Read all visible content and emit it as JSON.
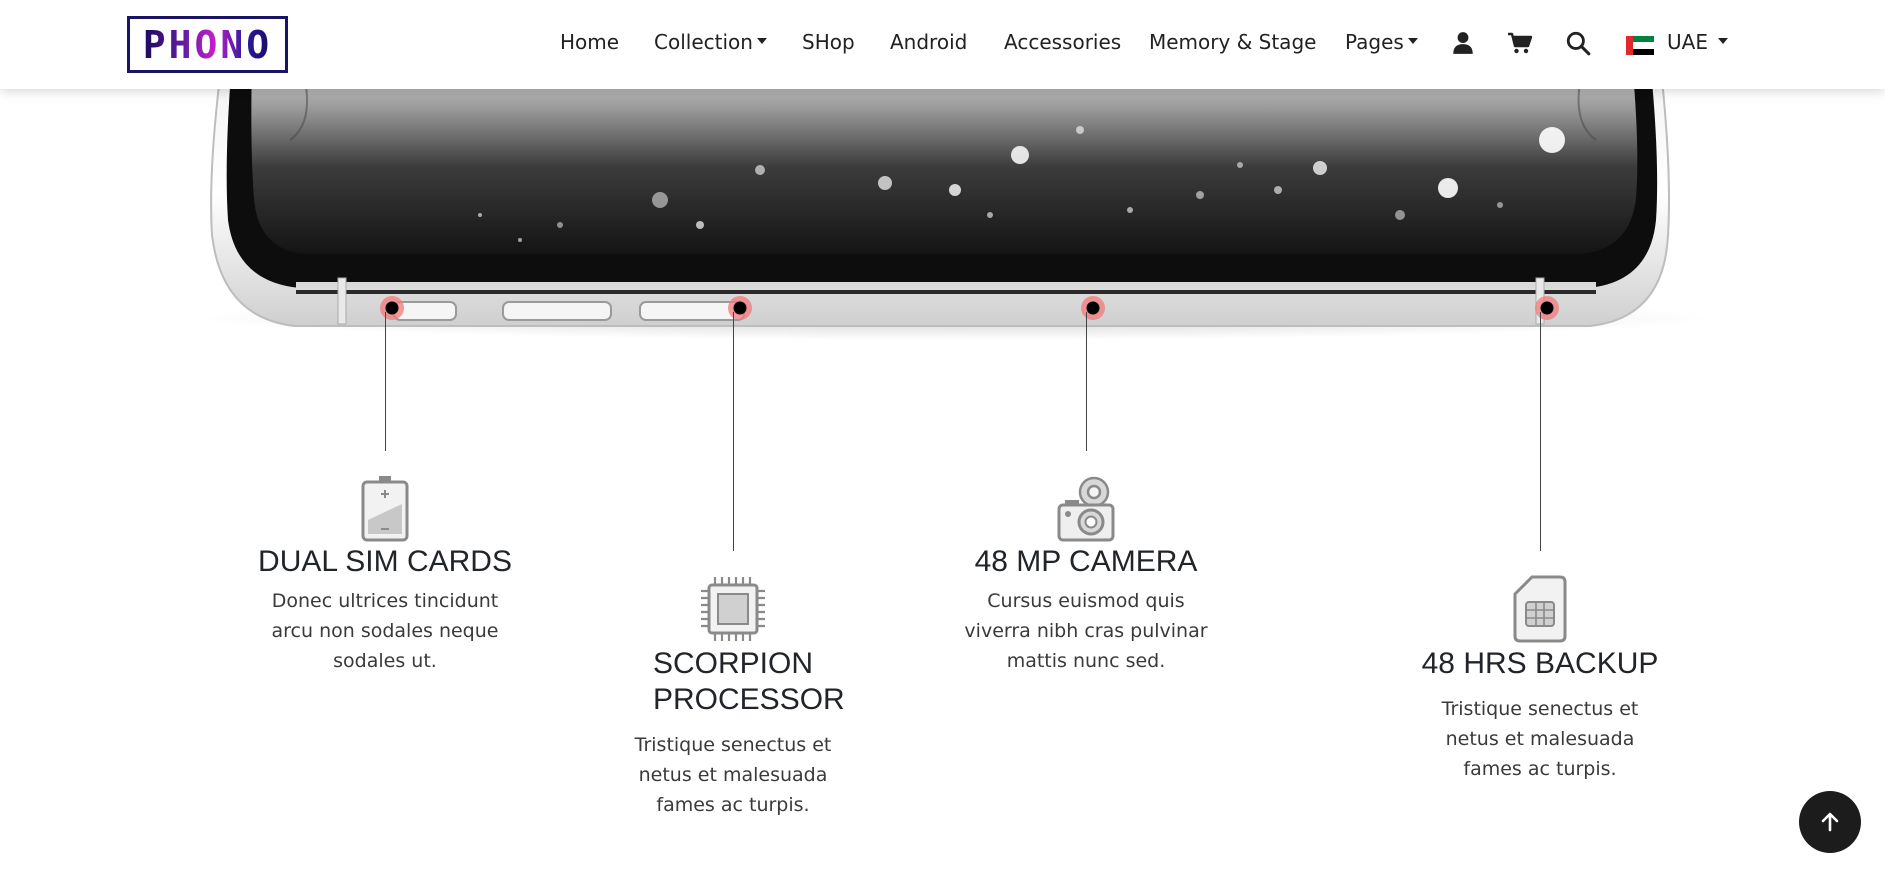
{
  "brand": {
    "logo_text": "PHONO"
  },
  "nav": {
    "items": [
      {
        "label": "Home",
        "dropdown": false
      },
      {
        "label": "Collection",
        "dropdown": true
      },
      {
        "label": "SHop",
        "dropdown": false
      },
      {
        "label": "Android",
        "dropdown": false
      },
      {
        "label": "Accessories",
        "dropdown": false
      },
      {
        "label": "Memory & Stage",
        "dropdown": false
      },
      {
        "label": "Pages",
        "dropdown": true
      }
    ],
    "icons": [
      "user-icon",
      "cart-icon",
      "search-icon"
    ],
    "region": {
      "label": "UAE",
      "flag": "uae-flag-icon"
    }
  },
  "features": [
    {
      "icon": "battery-icon",
      "title": "DUAL SIM CARDS",
      "text": "Donec ultrices tincidunt arcu non sodales neque sodales ut."
    },
    {
      "icon": "processor-chip-icon",
      "title": "SCORPION PROCESSOR",
      "text": "Tristique senectus et netus et malesuada fames ac turpis."
    },
    {
      "icon": "camera-icon",
      "title": "48 MP CAMERA",
      "text": "Cursus euismod quis viverra nibh cras pulvinar mattis nunc sed."
    },
    {
      "icon": "sim-card-icon",
      "title": "48 HRS BACKUP",
      "text": "Tristique senectus et netus et malesuada fames ac turpis."
    }
  ],
  "back_to_top": {
    "icon": "arrow-up-icon"
  },
  "colors": {
    "accent": "#e02020",
    "nav_text": "#222222",
    "logo_border": "#1a1464"
  }
}
